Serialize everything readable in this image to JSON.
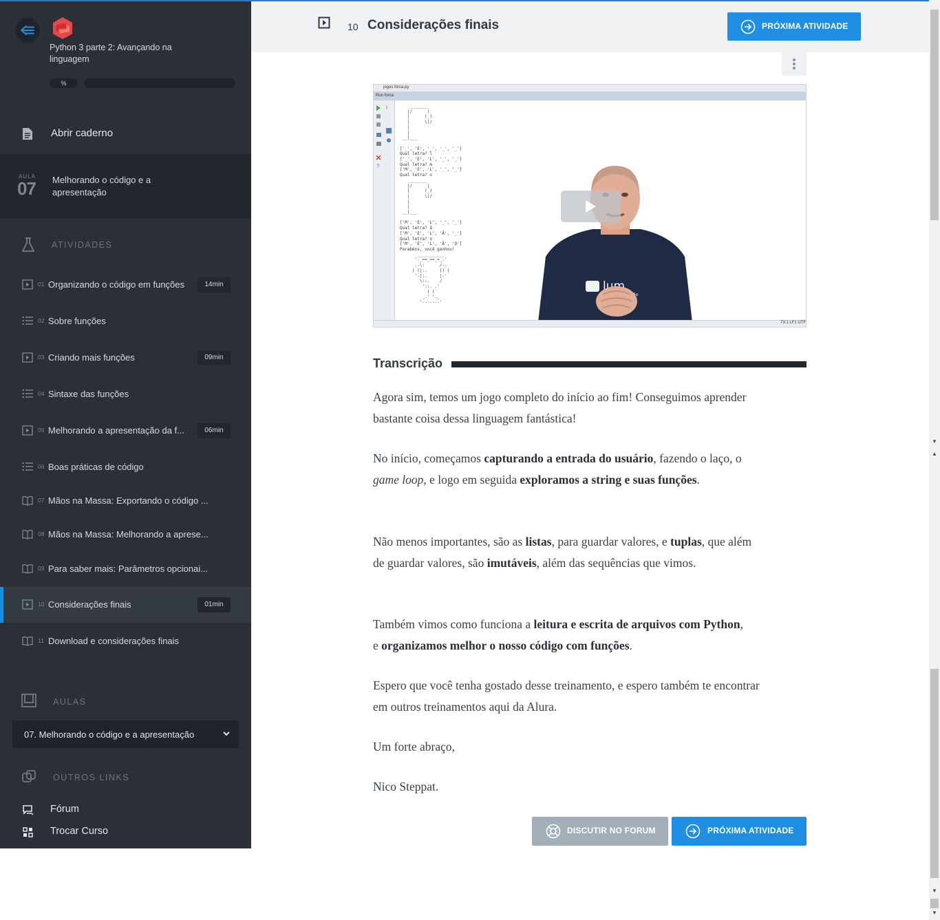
{
  "course": {
    "title": "Python 3 parte 2: Avançando na linguagem",
    "progress_label": "%",
    "progress": 0
  },
  "sidebar": {
    "notebook_label": "Abrir caderno",
    "current_lesson": {
      "aula_label": "AULA",
      "number": "07",
      "title": "Melhorando o código e a apresentação"
    },
    "activities_heading": "ATIVIDADES",
    "activities": [
      {
        "num": "01",
        "label": "Organizando o código em funções",
        "duration": "14min",
        "icon": "video-icon"
      },
      {
        "num": "02",
        "label": "Sobre funções",
        "duration": "",
        "icon": "list-icon"
      },
      {
        "num": "03",
        "label": "Criando mais funções",
        "duration": "09min",
        "icon": "video-icon"
      },
      {
        "num": "04",
        "label": "Sintaxe das funções",
        "duration": "",
        "icon": "list-icon"
      },
      {
        "num": "05",
        "label": "Melhorando a apresentação da f...",
        "duration": "06min",
        "icon": "video-icon"
      },
      {
        "num": "06",
        "label": "Boas práticas de código",
        "duration": "",
        "icon": "list-icon"
      },
      {
        "num": "07",
        "label": "Mãos na Massa: Exportando o código ...",
        "duration": "",
        "icon": "book-icon"
      },
      {
        "num": "08",
        "label": "Mãos na Massa: Melhorando a aprese...",
        "duration": "",
        "icon": "book-icon"
      },
      {
        "num": "09",
        "label": "Para saber mais: Parâmetros opcionai...",
        "duration": "",
        "icon": "book-icon"
      },
      {
        "num": "10",
        "label": "Considerações finais",
        "duration": "01min",
        "icon": "video-icon"
      },
      {
        "num": "11",
        "label": "Download e considerações finais",
        "duration": "",
        "icon": "book-icon"
      }
    ],
    "aulas_heading": "AULAS",
    "aulas_selected": "07. Melhorando o código e a apresentação",
    "other_links_heading": "OUTROS LINKS",
    "links": [
      {
        "label": "Fórum"
      },
      {
        "label": "Trocar Curso"
      }
    ]
  },
  "header": {
    "number": "10",
    "title": "Considerações finais",
    "next_button": "PRÓXIMA ATIVIDADE"
  },
  "video": {
    "breadcrumb": "jogos  forca.py",
    "run_label": "Run  forca",
    "status": "73:1  LF‡  UTF"
  },
  "transcript": {
    "heading": "Transcrição",
    "p1": "Agora sim, temos um jogo completo do início ao fim! Conseguimos aprender bastante coisa dessa linguagem fantástica!",
    "p2_a": "No início, começamos ",
    "p2_b": "capturando a entrada do usuário",
    "p2_c": ", fazendo o laço, o ",
    "p2_d": "game loop",
    "p2_e": ", e logo em seguida ",
    "p2_f": "exploramos a string e suas funções",
    "p2_g": ".",
    "p3_a": "Não menos importantes, são as ",
    "p3_b": "listas",
    "p3_c": ", para guardar valores, e ",
    "p3_d": "tuplas",
    "p3_e": ", que além de guardar valores, são ",
    "p3_f": "imutáveis",
    "p3_g": ", além das sequências que vimos.",
    "p4_a": "Também vimos como funciona a ",
    "p4_b": "leitura e escrita de arquivos com Python",
    "p4_c": ", e ",
    "p4_d": "organizamos melhor o nosso código com funções",
    "p4_e": ".",
    "p5": "Espero que você tenha gostado desse treinamento, e espero também te encontrar em outros treinamentos aqui da Alura.",
    "p6": "Um forte abraço,",
    "p7": "Nico Steppat."
  },
  "footer_buttons": {
    "forum": "DISCUTIR NO FORUM",
    "next": "PRÓXIMA ATIVIDADE"
  },
  "colors": {
    "accent": "#1e8fe2",
    "sidebar_bg": "#2b3037",
    "python_logo": "#e8484a"
  }
}
